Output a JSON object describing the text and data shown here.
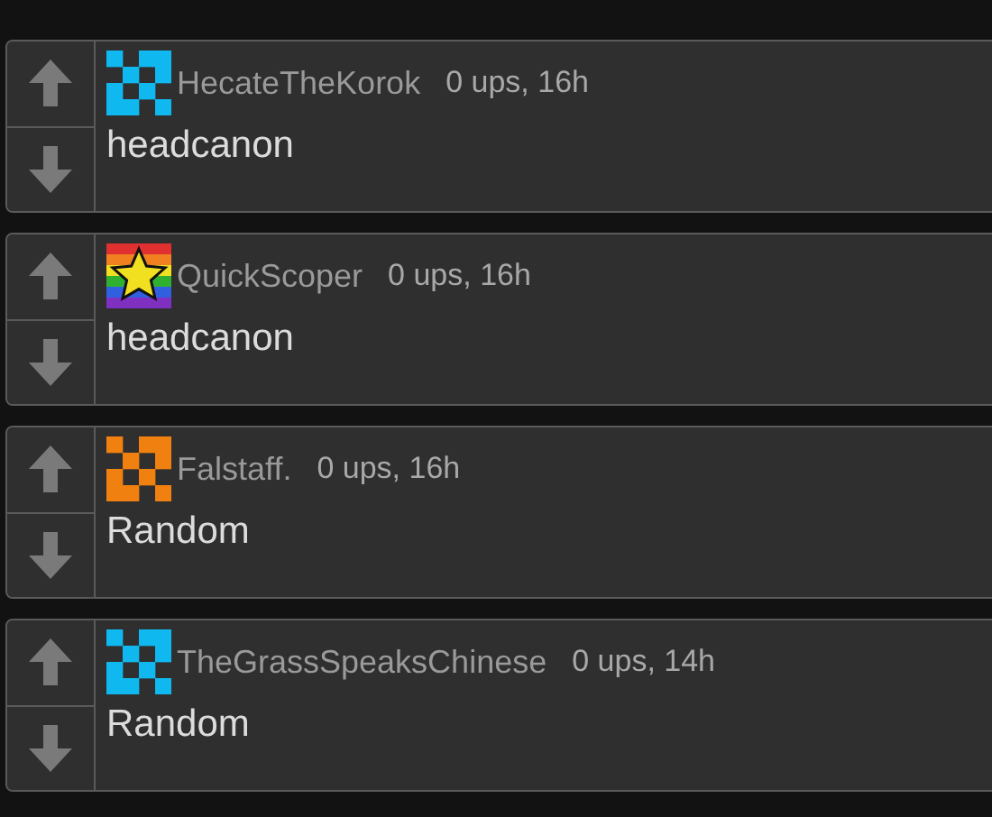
{
  "comments": [
    {
      "username": "HecateTheKorok",
      "meta": "0 ups, 16h",
      "text": "headcanon",
      "avatar": {
        "kind": "pixel",
        "color": "#10b8f0"
      }
    },
    {
      "username": "QuickScoper",
      "meta": "0 ups, 16h",
      "text": "headcanon",
      "avatar": {
        "kind": "star",
        "color": "#f0e020"
      }
    },
    {
      "username": "Falstaff.",
      "meta": "0 ups, 16h",
      "text": "Random",
      "avatar": {
        "kind": "pixel",
        "color": "#f08010"
      }
    },
    {
      "username": "TheGrassSpeaksChinese",
      "meta": "0 ups, 14h",
      "text": "Random",
      "avatar": {
        "kind": "pixel",
        "color": "#10b8f0"
      }
    }
  ]
}
